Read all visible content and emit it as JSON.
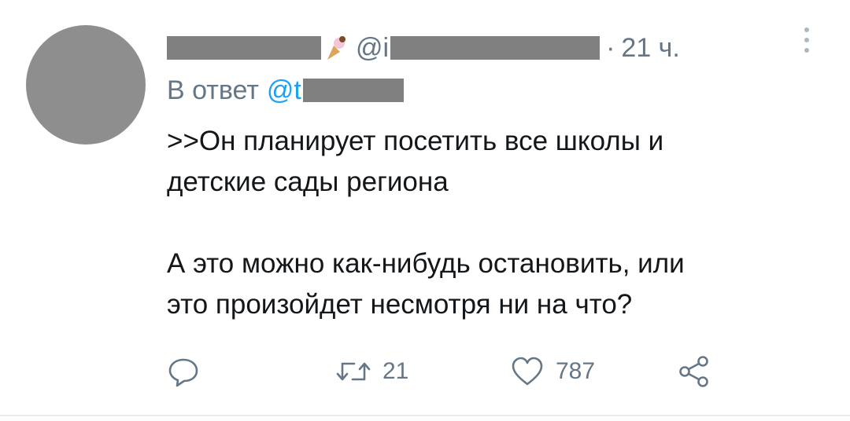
{
  "tweet": {
    "handle_prefix": "@i",
    "separator": "·",
    "time": "21 ч.",
    "reply_label": "В ответ",
    "reply_handle_prefix": "@t",
    "text": ">>Он планирует посетить все школы и\nдетские сады региона\n\nА это можно как-нибудь остановить, или\nэто произойдет несмотря ни на что?",
    "actions": {
      "reply_icon": "comment-icon",
      "retweet_icon": "retweet-icon",
      "retweet_count": "21",
      "like_icon": "heart-icon",
      "like_count": "787",
      "share_icon": "share-icon"
    }
  },
  "colors": {
    "text": "#14171a",
    "secondary": "#657786",
    "link": "#1da1f2",
    "redaction": "#808080",
    "avatar": "#8e8e8e",
    "divider": "#e6ecf0"
  }
}
